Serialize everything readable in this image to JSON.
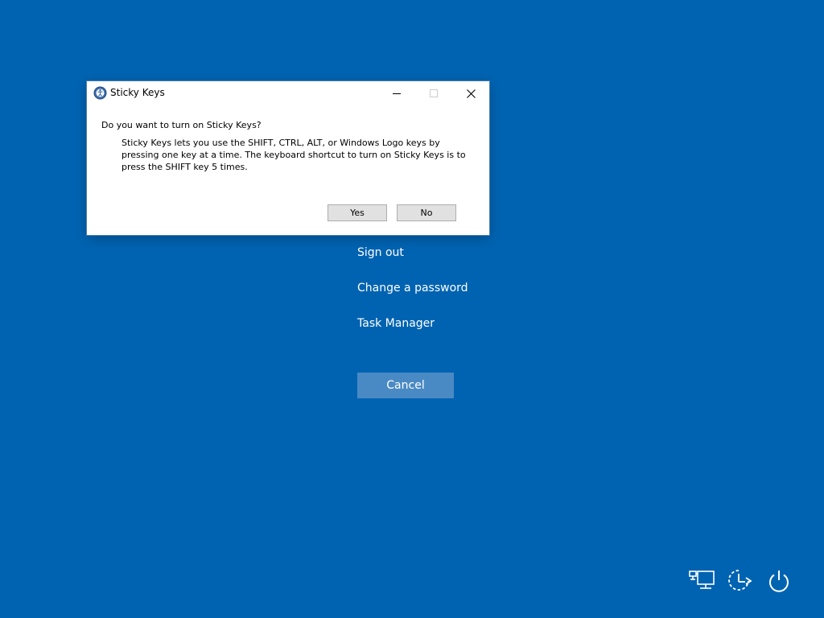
{
  "security_screen": {
    "options": [
      "Sign out",
      "Change a password",
      "Task Manager"
    ],
    "cancel_label": "Cancel"
  },
  "tray_icons": [
    "network-icon",
    "ease-of-access-icon",
    "power-icon"
  ],
  "dialog": {
    "title": "Sticky Keys",
    "question": "Do you want to turn on Sticky Keys?",
    "description": "Sticky Keys lets you use the SHIFT, CTRL, ALT, or Windows Logo keys by pressing one key at a time. The keyboard shortcut to turn on Sticky Keys is to press the SHIFT key 5 times.",
    "yes_label": "Yes",
    "no_label": "No",
    "icons": {
      "app": "sticky-keys-icon",
      "minimize": "minimize-icon",
      "maximize": "maximize-icon",
      "close": "close-icon"
    }
  },
  "colors": {
    "background": "#0063b1",
    "cancel_button": "#4a8ac4",
    "dialog_background": "#ffffff"
  }
}
